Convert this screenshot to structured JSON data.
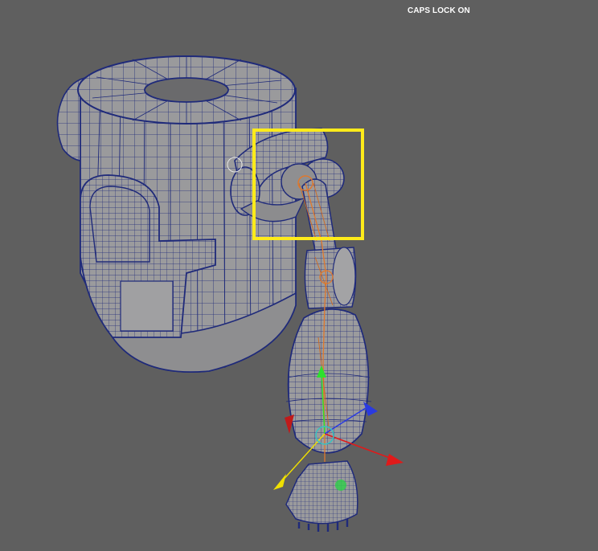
{
  "viewport": {
    "hud": {
      "caps_lock": "CAPS LOCK ON"
    },
    "colors": {
      "background": "#5f5f5f",
      "mesh_fill": "#9a9a9c",
      "mesh_fill_light": "#a9a9ab",
      "wireframe": "#1f2a7a",
      "selection": "#ffeb1a",
      "joint": "#e0782c",
      "gizmo_x": "#e01a1a",
      "gizmo_y": "#2de02d",
      "gizmo_z": "#2a3ae0",
      "gizmo_pivot": "#f0e000"
    },
    "objects": [
      "cup-body",
      "cup-rim",
      "cup-handle",
      "cup-window",
      "arm-shoulder",
      "arm-upper",
      "arm-elbow",
      "arm-forearm",
      "arm-hand"
    ],
    "tools": [
      "selection-marquee",
      "transform-gizmo"
    ]
  }
}
